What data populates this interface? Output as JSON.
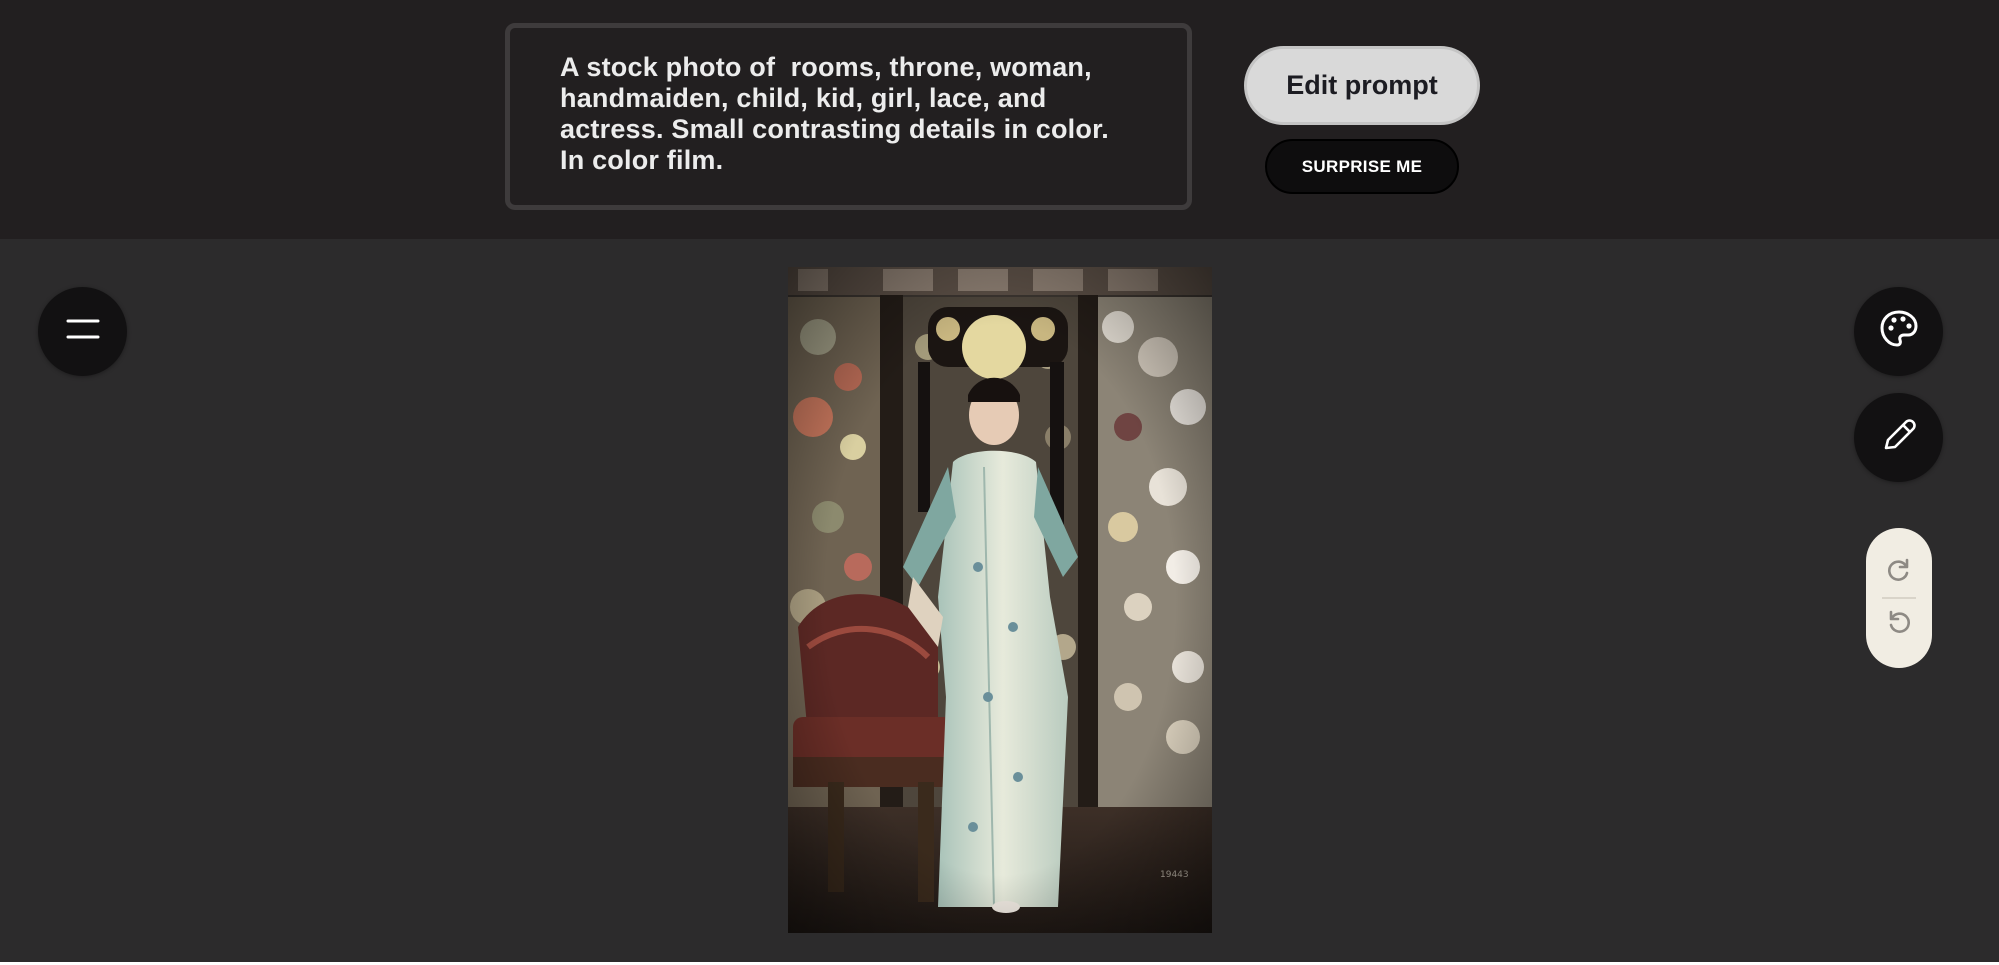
{
  "prompt": {
    "text": "A stock photo of  rooms, throne, woman,\nhandmaiden, child, kid, girl, lace, and\nactress. Small contrasting details in color.\nIn color film."
  },
  "actions": {
    "edit_label": "Edit prompt",
    "surprise_label": "SURPRISE ME"
  },
  "toolbar": {
    "menu_icon": "hamburger-menu-icon",
    "palette_icon": "palette-icon",
    "pencil_icon": "pencil-icon",
    "redo_icon": "redo-icon",
    "undo_icon": "undo-icon"
  },
  "image": {
    "description_icon": "generated-image",
    "stamp_text": "19443"
  },
  "colors": {
    "topbar_bg": "#221f20",
    "canvas_bg": "#2c2b2c",
    "edit_button_bg": "#d9d9d9",
    "surprise_button_bg": "#0e0d0e",
    "round_button_bg": "#121112",
    "history_pill_bg": "#f1ede3"
  }
}
